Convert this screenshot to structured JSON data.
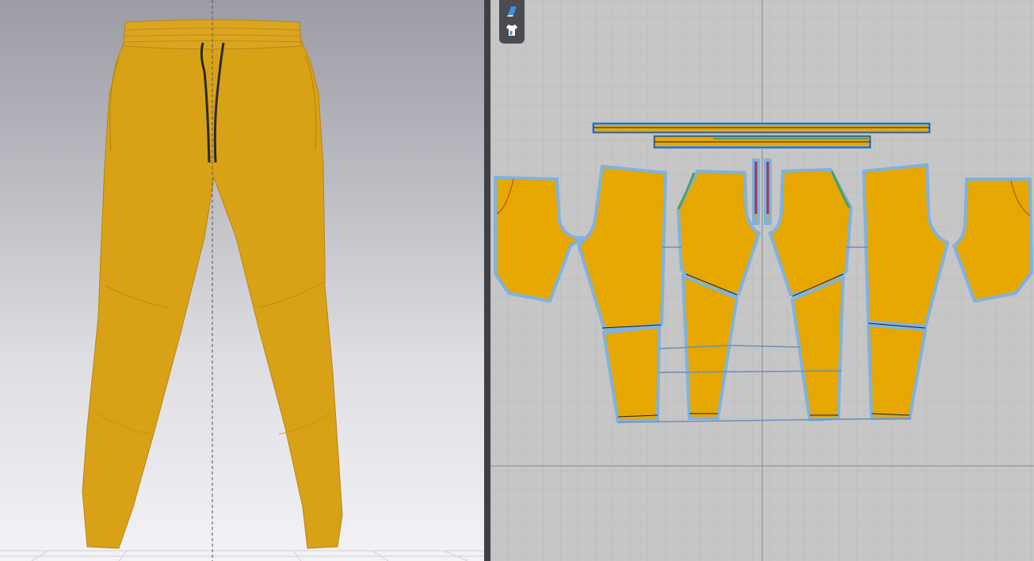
{
  "app": {
    "views": {
      "avatar_view": {
        "type": "3d",
        "garment": "jogger-pants",
        "background": [
          "#9c9ca4",
          "#f3f3f6"
        ]
      },
      "pattern_view": {
        "type": "2d",
        "background": "#c6c6c6"
      }
    },
    "toolbar": {
      "items": [
        {
          "name": "fabric-tool-icon",
          "active": false
        },
        {
          "name": "garment-tool-icon",
          "active": true
        }
      ]
    },
    "colors": {
      "fabric": "#d9a116",
      "pattern_fill": "#e5a700",
      "pattern_outline": "#7fb2df",
      "seam_line": "#6f8fb5",
      "drawcord": "#2a2a2a",
      "grid": "#b8b8b8"
    }
  }
}
